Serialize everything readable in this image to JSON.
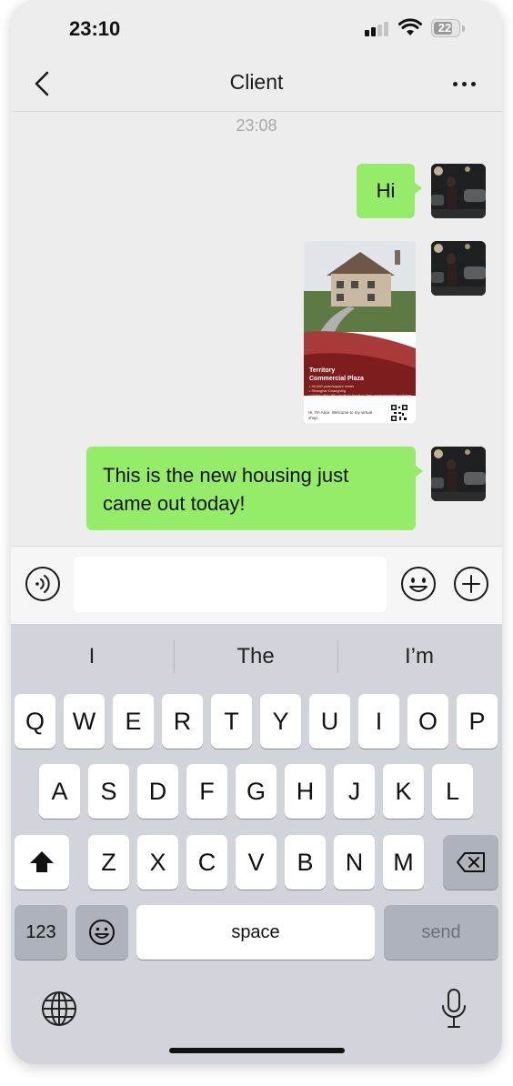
{
  "status_bar": {
    "time": "23:10",
    "battery": "22"
  },
  "nav": {
    "title": "Client",
    "back_icon": "chevron-left-icon",
    "more_icon": "ellipsis-icon"
  },
  "chat": {
    "timestamp": "23:08",
    "messages": [
      {
        "type": "text",
        "side": "right",
        "text": "Hi"
      },
      {
        "type": "image",
        "side": "right",
        "card": {
          "title_line1": "Territory",
          "title_line2": "Commercial Plaza",
          "bullets": [
            "40,000 yuan/square meter",
            "Shanghai·Changning",
            "Urban villa with vacation function,Zero environmental pollution"
          ],
          "footer": "Hi, I'm Alice. Welcome to my virtual shop."
        }
      },
      {
        "type": "text",
        "side": "right",
        "text": "This is the new housing just came out today!"
      }
    ]
  },
  "input_bar": {
    "placeholder": "",
    "value": ""
  },
  "keyboard": {
    "suggestions": [
      "I",
      "The",
      "I’m"
    ],
    "row1": [
      "Q",
      "W",
      "E",
      "R",
      "T",
      "Y",
      "U",
      "I",
      "O",
      "P"
    ],
    "row2": [
      "A",
      "S",
      "D",
      "F",
      "G",
      "H",
      "J",
      "K",
      "L"
    ],
    "row3": [
      "Z",
      "X",
      "C",
      "V",
      "B",
      "N",
      "M"
    ],
    "numbers_key": "123",
    "space_key": "space",
    "send_key": "send"
  },
  "colors": {
    "bubble": "#95ec69",
    "background": "#ededed",
    "keyboard": "#d1d4db"
  }
}
